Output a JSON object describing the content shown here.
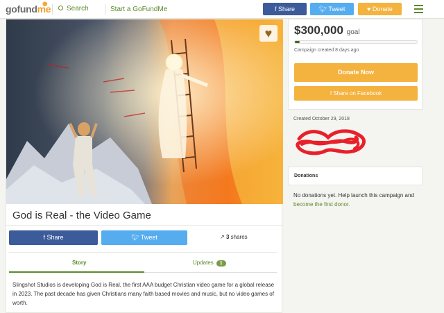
{
  "header": {
    "logo_go": "gofund",
    "logo_me": "me",
    "search_label": "Search",
    "start_label": "Start a GoFundMe",
    "share_label": "Share",
    "tweet_label": "Tweet",
    "donate_label": "Donate"
  },
  "campaign": {
    "title": "God is Real - the Video Game",
    "share_label": "Share",
    "tweet_label": "Tweet",
    "shares_count": "3",
    "shares_label": "shares",
    "tabs": {
      "story": "Story",
      "updates": "Updates",
      "updates_count": "1"
    },
    "story_text": "Slingshot Studios is developing God is Real, the first AAA budget Christian video game for a global release in 2023.  The past decade has given Christians many faith based movies and music, but no video games of worth."
  },
  "sidebar": {
    "goal_amount": "$300,000",
    "goal_label": "goal",
    "progress_fraction": 0.04,
    "created_relative": "Campaign created 8 days ago",
    "donate_now": "Donate Now",
    "share_facebook": "Share on Facebook",
    "created_date": "Created October 29, 2018",
    "donations_header": "Donations",
    "no_donations_text": "No donations yet. Help launch this campaign and",
    "first_donor_link": "become the first donor."
  },
  "colors": {
    "brand_green": "#5b8a2a",
    "facebook": "#3c5b9a",
    "twitter": "#55acee",
    "donate": "#f4b23e"
  }
}
